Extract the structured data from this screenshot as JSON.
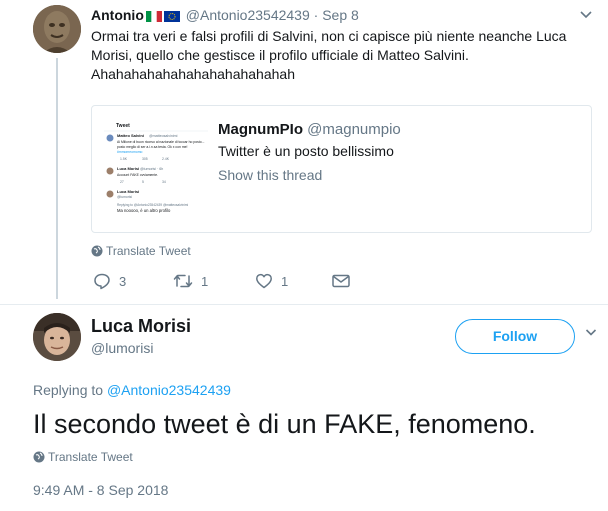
{
  "tweet1": {
    "author_name": "Antonio",
    "flags": [
      "italy-flag",
      "eu-flag"
    ],
    "handle": "@Antonio23542439",
    "separator": "·",
    "date": "Sep 8",
    "text": "Ormai tra veri e falsi profili di Salvini, non ci capisce più niente neanche Luca Morisi, quello che gestisce il profilo ufficiale di Matteo Salvini. Ahahahahahahahahahahahahah",
    "quote": {
      "author_name": "MagnumPIo",
      "handle": "@magnumpio",
      "text": "Twitter è un posto bellissimo",
      "show_thread": "Show this thread",
      "thumbnail": {
        "title": "Tweet",
        "rows": [
          {
            "name": "Matteo Salvini",
            "handle": "@matteosalvinimi",
            "text": "Ai Milione di buon ricorso al nazionale di toccar ho posto...",
            "counts": [
              "1.5K",
              "305",
              "2.4K"
            ]
          },
          {
            "name": "Luca Morisi",
            "handle": "@lumorisi · 6h",
            "text": "Account FAKE ovviamente.",
            "counts": [
              "27",
              "5",
              "34"
            ]
          },
          {
            "name": "Luca Morisi",
            "handle": "@lumorisi",
            "text": "Replying to @Antonio23542439 @matteosalvinimi",
            "counts": []
          }
        ]
      }
    },
    "translate_label": "Translate Tweet",
    "actions": {
      "replies": "3",
      "retweets": "1",
      "likes": "1"
    }
  },
  "tweet2": {
    "author_name": "Luca Morisi",
    "handle": "@lumorisi",
    "follow_label": "Follow",
    "replying_prefix": "Replying to",
    "replying_to": "@Antonio23542439",
    "text": "Il secondo tweet è di un FAKE, fenomeno.",
    "translate_label": "Translate Tweet",
    "timestamp": "9:49 AM - 8 Sep 2018"
  },
  "colors": {
    "accent": "#1da1f2",
    "muted": "#657786",
    "text": "#14171a",
    "border": "#e1e8ed"
  }
}
